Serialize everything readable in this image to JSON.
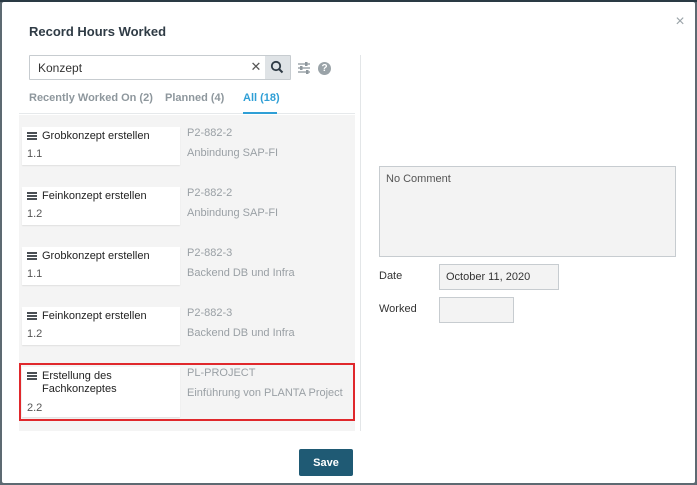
{
  "dialog": {
    "title": "Record Hours Worked",
    "close_glyph": "×"
  },
  "search": {
    "value": "Konzept",
    "clear_glyph": "✕",
    "search_icon": "magnifier-icon",
    "filter_icon": "sliders-icon",
    "help_glyph": "?"
  },
  "tabs": [
    {
      "label": "Recently Worked On (2)"
    },
    {
      "label": "Planned (4)"
    },
    {
      "label": "All (18)"
    }
  ],
  "items": [
    {
      "title": "Grobkonzept erstellen",
      "wbs": "1.1",
      "code": "P2-882-2",
      "project": "Anbindung SAP-FI"
    },
    {
      "title": "Feinkonzept erstellen",
      "wbs": "1.2",
      "code": "P2-882-2",
      "project": "Anbindung SAP-FI"
    },
    {
      "title": "Grobkonzept erstellen",
      "wbs": "1.1",
      "code": "P2-882-3",
      "project": "Backend DB und Infra"
    },
    {
      "title": "Feinkonzept erstellen",
      "wbs": "1.2",
      "code": "P2-882-3",
      "project": "Backend DB und Infra"
    },
    {
      "title": "Erstellung des Fachkonzeptes",
      "wbs": "2.2",
      "code": "PL-PROJECT",
      "project": "Einführung von PLANTA Project"
    }
  ],
  "form": {
    "comment": "No Comment",
    "date_label": "Date",
    "date_value": "October 11, 2020",
    "worked_label": "Worked",
    "worked_value": ""
  },
  "save_label": "Save",
  "colors": {
    "accent": "#2f9fd6",
    "primary_button": "#1f5a74",
    "selection_border": "#e0282c"
  }
}
